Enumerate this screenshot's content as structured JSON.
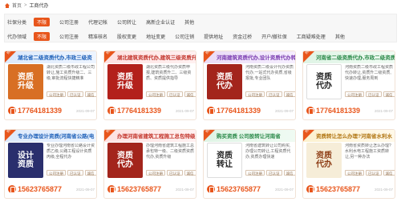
{
  "breadcrumb": {
    "home": "首页",
    "separator": ">",
    "current": "工商代办"
  },
  "filters": {
    "rows": [
      {
        "label": "社保分类",
        "options": [
          {
            "text": "不限",
            "active": true
          },
          {
            "text": "公司注册",
            "active": false
          },
          {
            "text": "代理记帐",
            "active": false
          },
          {
            "text": "公司转让",
            "active": false
          },
          {
            "text": "高新企业认证",
            "active": false
          },
          {
            "text": "其他",
            "active": false
          }
        ]
      },
      {
        "label": "代办领域",
        "options": [
          {
            "text": "不限",
            "active": true
          },
          {
            "text": "公司注册",
            "active": false
          },
          {
            "text": "精准核名",
            "active": false
          },
          {
            "text": "股权变更",
            "active": false
          },
          {
            "text": "地址变更",
            "active": false
          },
          {
            "text": "公司注销",
            "active": false
          },
          {
            "text": "提供地址",
            "active": false
          },
          {
            "text": "资金过桥",
            "active": false
          },
          {
            "text": "开户/撤社保",
            "active": false
          },
          {
            "text": "工商疑难处理",
            "active": false
          },
          {
            "text": "其他",
            "active": false
          }
        ]
      }
    ]
  },
  "cards": [
    {
      "hot": "热门",
      "title": "湖北省二级资质代办,市政三级资",
      "thumb_line1": "资质",
      "thumb_line2": "升级",
      "description": "湖北资质二级市政工程公司转让,施工资质升级二、三级,审批流程快捷精准",
      "tags": [
        "公司注册",
        "已认证",
        "诚信"
      ],
      "phone": "17764181339",
      "date": "2021-09-07",
      "theme": "theme-blue",
      "thumb_style": "th-orange"
    },
    {
      "hot": "热门",
      "title": "湖北建筑资质代办,建筑三级资质升",
      "thumb_line1": "资质",
      "thumb_line2": "升级",
      "description": "湖北资质三级代办资质申报,建筑资质升二、三级资质、资质提供指导",
      "tags": [
        "公司注册",
        "已认证",
        "诚信"
      ],
      "phone": "17764181339",
      "date": "2021-09-07",
      "theme": "theme-pink",
      "thumb_style": "th-red"
    },
    {
      "hot": "热门",
      "title": "河南建筑资质代办,设计资质代办转让",
      "thumb_line1": "资质",
      "thumb_line2": "代办",
      "description": "河南资质二级设计代办资质代办,一站式代办资质,省级报批,专业团队",
      "tags": [
        "公司注册",
        "已认证",
        "诚信"
      ],
      "phone": "17764181339",
      "date": "2021-09-07",
      "theme": "theme-purple",
      "thumb_style": "th-darkred"
    },
    {
      "hot": "热门",
      "title": "河南省二级资质代办,市政二级资质代",
      "thumb_line1": "资质",
      "thumb_line2": "代办",
      "description": "河南资质二级市政工程资质代办转让,资质升二级资质,快速办理,服务周到",
      "tags": [
        "公司注册",
        "已认证",
        "诚信"
      ],
      "phone": "17764181339",
      "date": "2021-09-07",
      "theme": "theme-green",
      "thumb_style": "th-white"
    },
    {
      "hot": "热门",
      "title": "专业办理设计资质(河南省公路(电",
      "thumb_line1": "设计",
      "thumb_line2": "资质",
      "description": "专业办理河南省公路设计资质乙级,公路工程设计资质丙级,全程代办",
      "tags": [
        "公司注册",
        "已认证",
        "诚信"
      ],
      "phone": "15623765877",
      "date": "2021-09-07",
      "theme": "theme-blue",
      "thumb_style": "th-navy"
    },
    {
      "hot": "热门",
      "title": "办理河南省建筑工程施工总包特级",
      "thumb_line1": "资质",
      "thumb_line2": "代办",
      "description": "办理河南省建筑工程施工总承包特一级、二级资质资质代办,资质升级",
      "tags": [
        "公司注册",
        "已认证",
        "诚信"
      ],
      "phone": "15623765877",
      "date": "2021-09-07",
      "theme": "theme-pink",
      "thumb_style": "th-darkred"
    },
    {
      "hot": "热门",
      "title": "购买资质 公司股转让河南省",
      "thumb_line1": "资质",
      "thumb_line2": "转让",
      "description": "河南省建筑转让公司购买,办理公司转让,工程资质代办,资质办理快速",
      "tags": [
        "公司注册",
        "已认证",
        "诚信"
      ],
      "phone": "15623765877",
      "date": "2021-09-07",
      "theme": "theme-green",
      "thumb_style": "th-white"
    },
    {
      "hot": "热门",
      "title": "资质转让怎么办理?河南省水利水",
      "thumb_line1": "资质",
      "thumb_line2": "代办",
      "description": "河南省资质转让怎么办理?水利水电工程施工资质转让,另一种办法",
      "tags": [
        "公司注册",
        "已认证",
        "诚信"
      ],
      "phone": "15623765877",
      "date": "2021-09-07",
      "theme": "theme-yellow",
      "thumb_style": "th-cream"
    }
  ]
}
